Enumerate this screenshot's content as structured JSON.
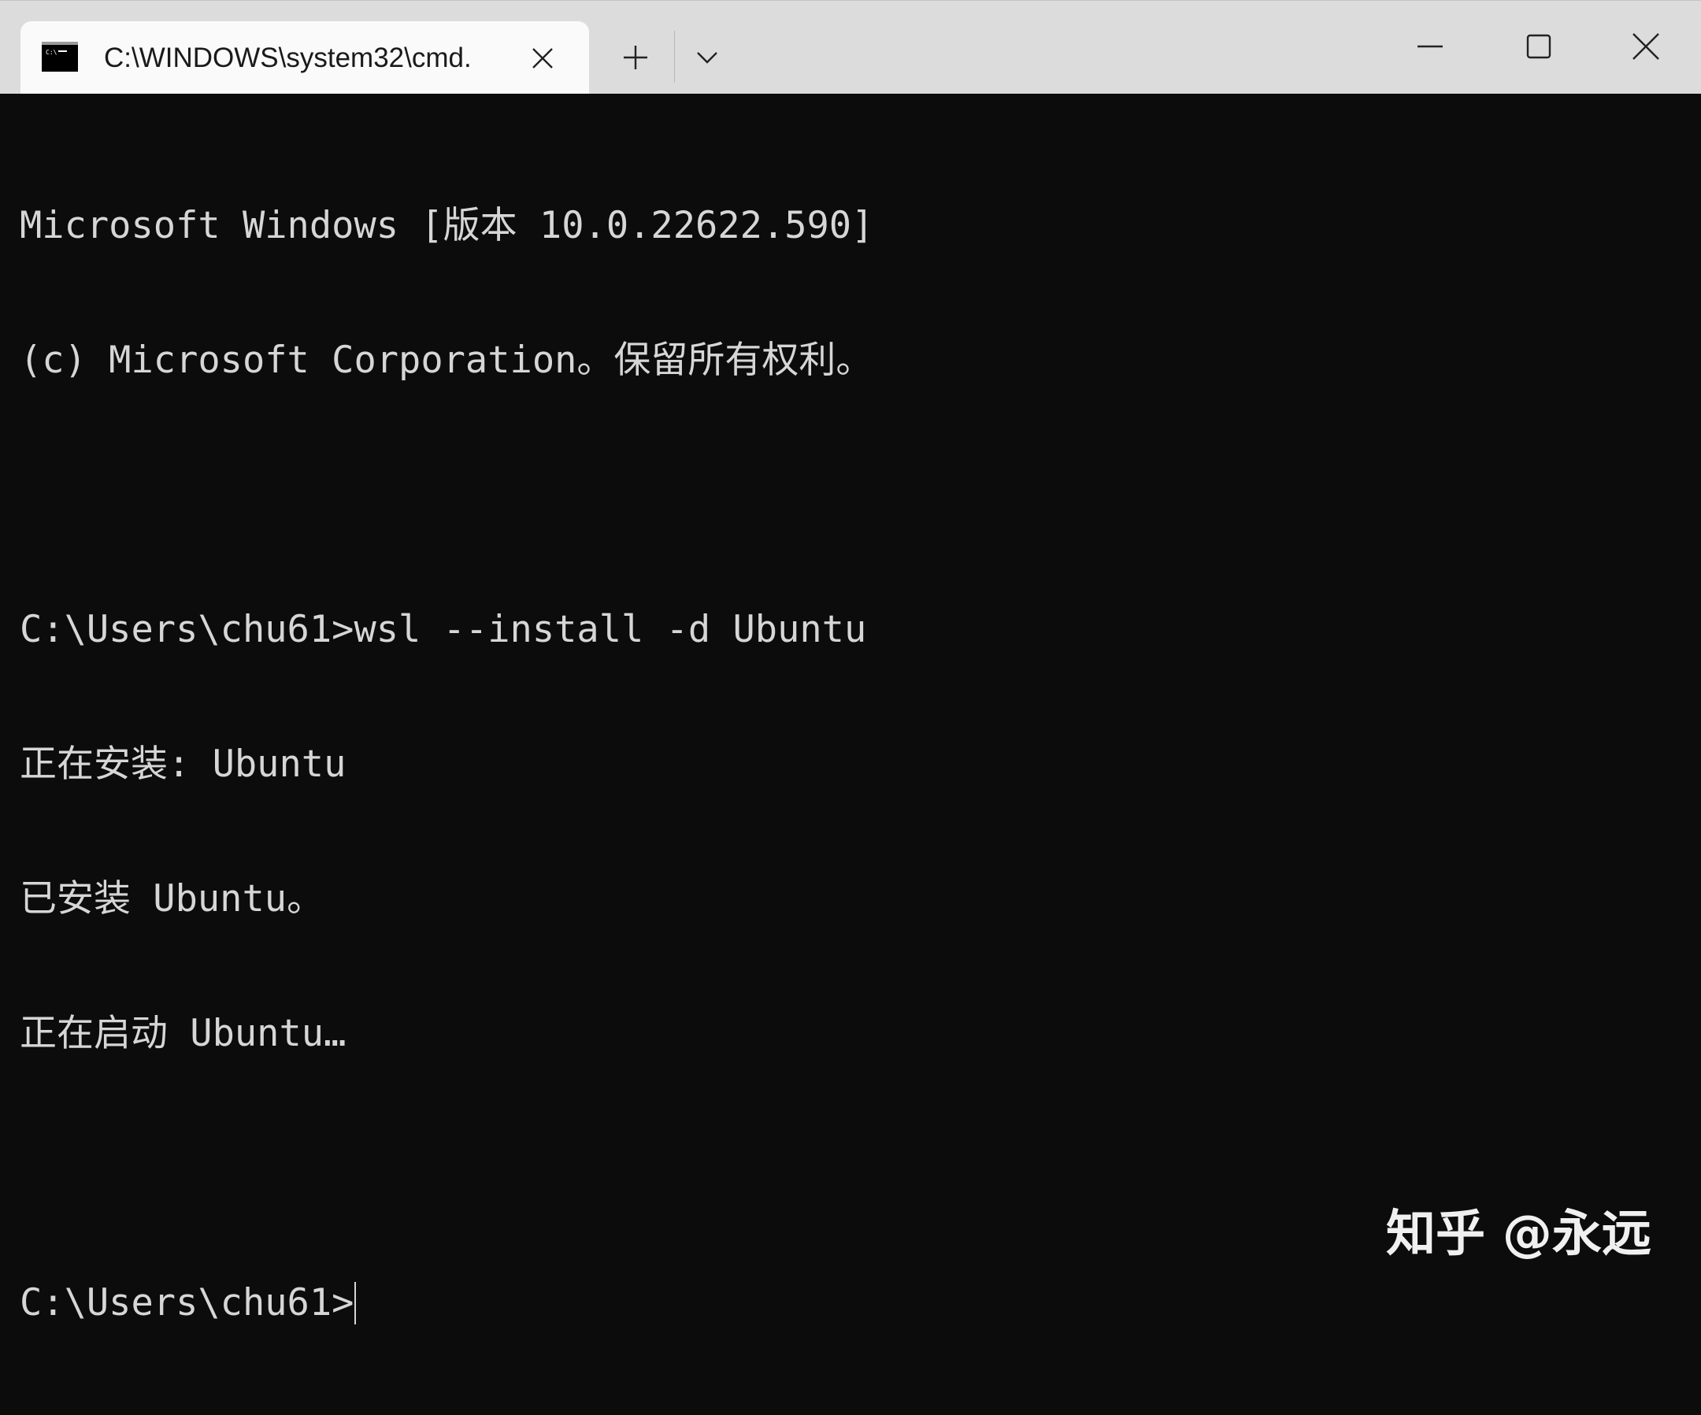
{
  "tab": {
    "title": "C:\\WINDOWS\\system32\\cmd.",
    "icon": "cmd-icon"
  },
  "titlebar": {
    "new_tab_icon": "plus-icon",
    "dropdown_icon": "chevron-down-icon",
    "minimize_icon": "minimize-icon",
    "maximize_icon": "maximize-icon",
    "close_icon": "close-icon"
  },
  "terminal": {
    "lines": [
      "Microsoft Windows [版本 10.0.22622.590]",
      "(c) Microsoft Corporation。保留所有权利。",
      "",
      "C:\\Users\\chu61>wsl --install -d Ubuntu",
      "正在安装: Ubuntu",
      "已安装 Ubuntu。",
      "正在启动 Ubuntu…",
      "",
      "C:\\Users\\chu61>"
    ],
    "background": "#0c0c0c",
    "foreground": "#d6d6d6"
  },
  "watermark": "知乎 @永远"
}
